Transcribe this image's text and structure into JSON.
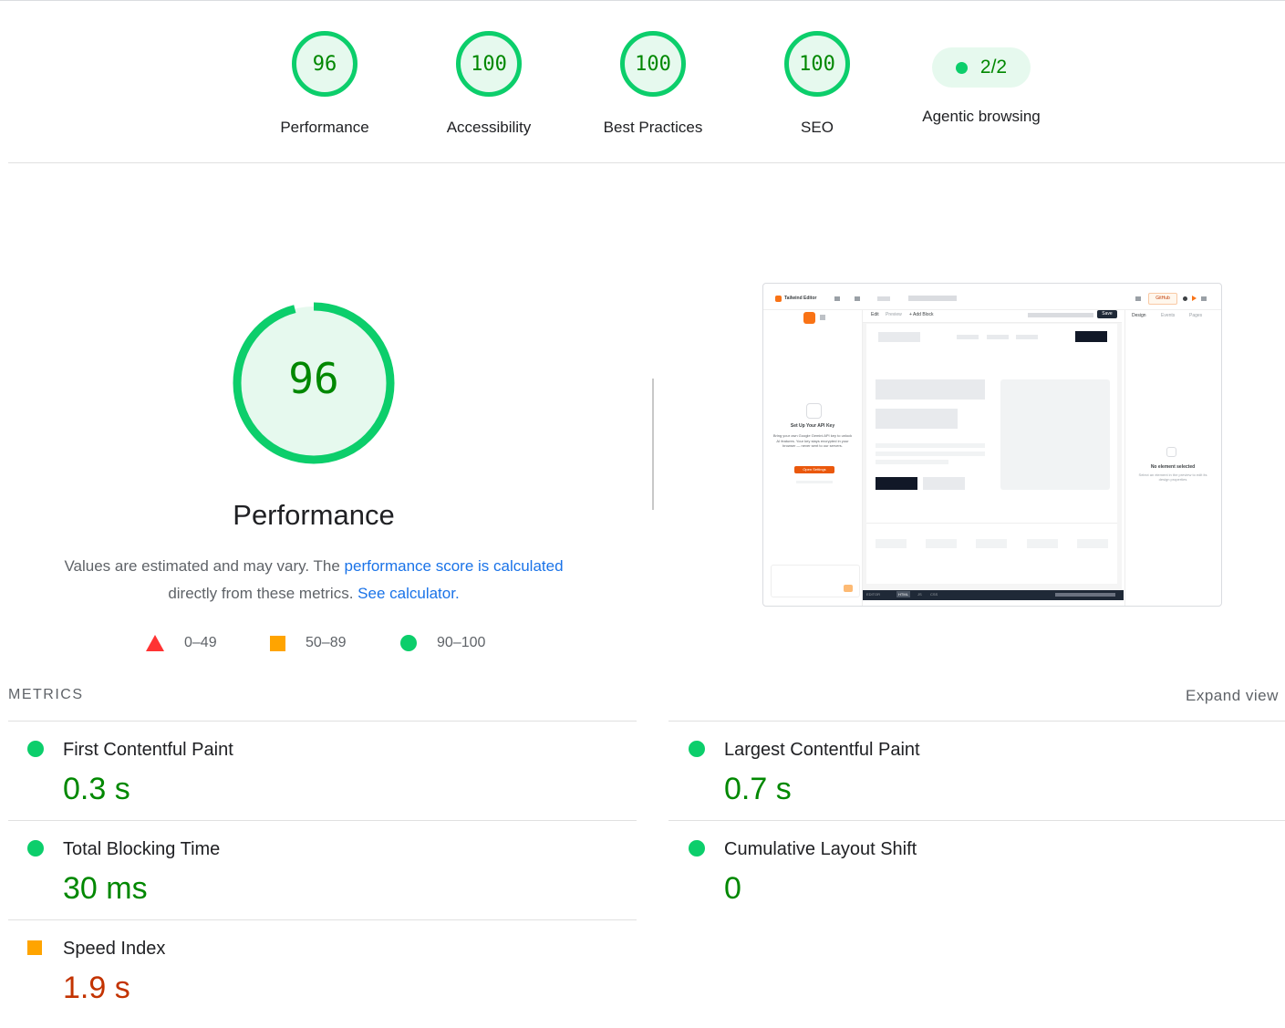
{
  "summary": {
    "gauges": [
      {
        "score": "96",
        "label": "Performance"
      },
      {
        "score": "100",
        "label": "Accessibility"
      },
      {
        "score": "100",
        "label": "Best Practices"
      },
      {
        "score": "100",
        "label": "SEO"
      }
    ],
    "agentic": {
      "value": "2/2",
      "label": "Agentic browsing"
    }
  },
  "performance": {
    "score": 96,
    "score_text": "96",
    "title": "Performance",
    "desc_prefix": "Values are estimated and may vary. The ",
    "desc_link": "performance score is calculated",
    "desc_middle": " directly from these metrics.",
    "desc_calc": "See calculator."
  },
  "legend": {
    "fail": "0–49",
    "average": "50–89",
    "pass": "90–100"
  },
  "thumbnail": {
    "app_title": "Tailwind Editor",
    "github": "GitHub",
    "tab_edit": "Edit",
    "tab_preview": "Preview",
    "add_block": "+ Add Block",
    "save": "Save",
    "design": "Design",
    "events": "Events",
    "pages": "Pages",
    "api_title": "Set Up Your API Key",
    "api_desc": "Bring your own Google Gemini API key to unlock AI features. Your key stays encrypted in your browser — never sent to our servers.",
    "open_settings": "Open Settings",
    "no_element": "No element selected",
    "no_element_desc": "Select an element in the preview to edit its design properties",
    "bar_editor": "EDITOR",
    "bar_html": "HTML",
    "bar_js": "JS",
    "bar_css": "CSS"
  },
  "metrics": {
    "title": "METRICS",
    "expand": "Expand view",
    "items": [
      {
        "name": "First Contentful Paint",
        "value": "0.3 s",
        "rating": "pass"
      },
      {
        "name": "Largest Contentful Paint",
        "value": "0.7 s",
        "rating": "pass"
      },
      {
        "name": "Total Blocking Time",
        "value": "30 ms",
        "rating": "pass"
      },
      {
        "name": "Cumulative Layout Shift",
        "value": "0",
        "rating": "pass"
      },
      {
        "name": "Speed Index",
        "value": "1.9 s",
        "rating": "average"
      }
    ]
  },
  "colors": {
    "pass": "#0cce6b",
    "pass_text": "#008800",
    "average": "#ffa400",
    "average_text": "#c33300",
    "fail": "#ff3333",
    "link": "#1a73e8"
  }
}
